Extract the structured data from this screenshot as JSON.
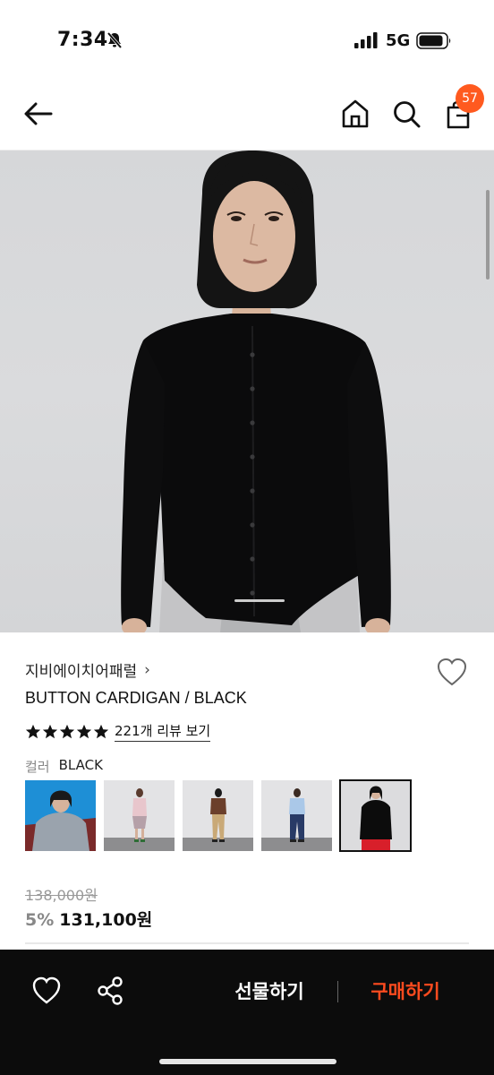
{
  "status_bar": {
    "time": "7:34",
    "network": "5G",
    "icons": [
      "bell-slash-icon",
      "signal-icon",
      "battery-icon"
    ]
  },
  "header": {
    "icons": [
      "back-arrow-icon",
      "home-icon",
      "search-icon",
      "shopping-bag-icon"
    ],
    "cart_count": "57",
    "accent_color": "#ff5a1f"
  },
  "product": {
    "brand": "지비에이치어패럴",
    "brand_chevron": "›",
    "name": "BUTTON CARDIGAN / BLACK",
    "rating_stars": 5,
    "review_link": "221개 리뷰 보기",
    "color_label": "컬러",
    "color_value": "BLACK",
    "thumbnails": [
      {
        "name": "thumb-blue-gray-cardigan",
        "selected": false
      },
      {
        "name": "thumb-pink-outfit",
        "selected": false
      },
      {
        "name": "thumb-brown-outfit",
        "selected": false
      },
      {
        "name": "thumb-light-blue-outfit",
        "selected": false
      },
      {
        "name": "thumb-black-outfit",
        "selected": true
      }
    ],
    "original_price": "138,000원",
    "discount_rate": "5%",
    "sale_price": "131,100원"
  },
  "bottom_bar": {
    "gift_label": "선물하기",
    "buy_label": "구매하기",
    "buy_color": "#ff4b1f"
  }
}
